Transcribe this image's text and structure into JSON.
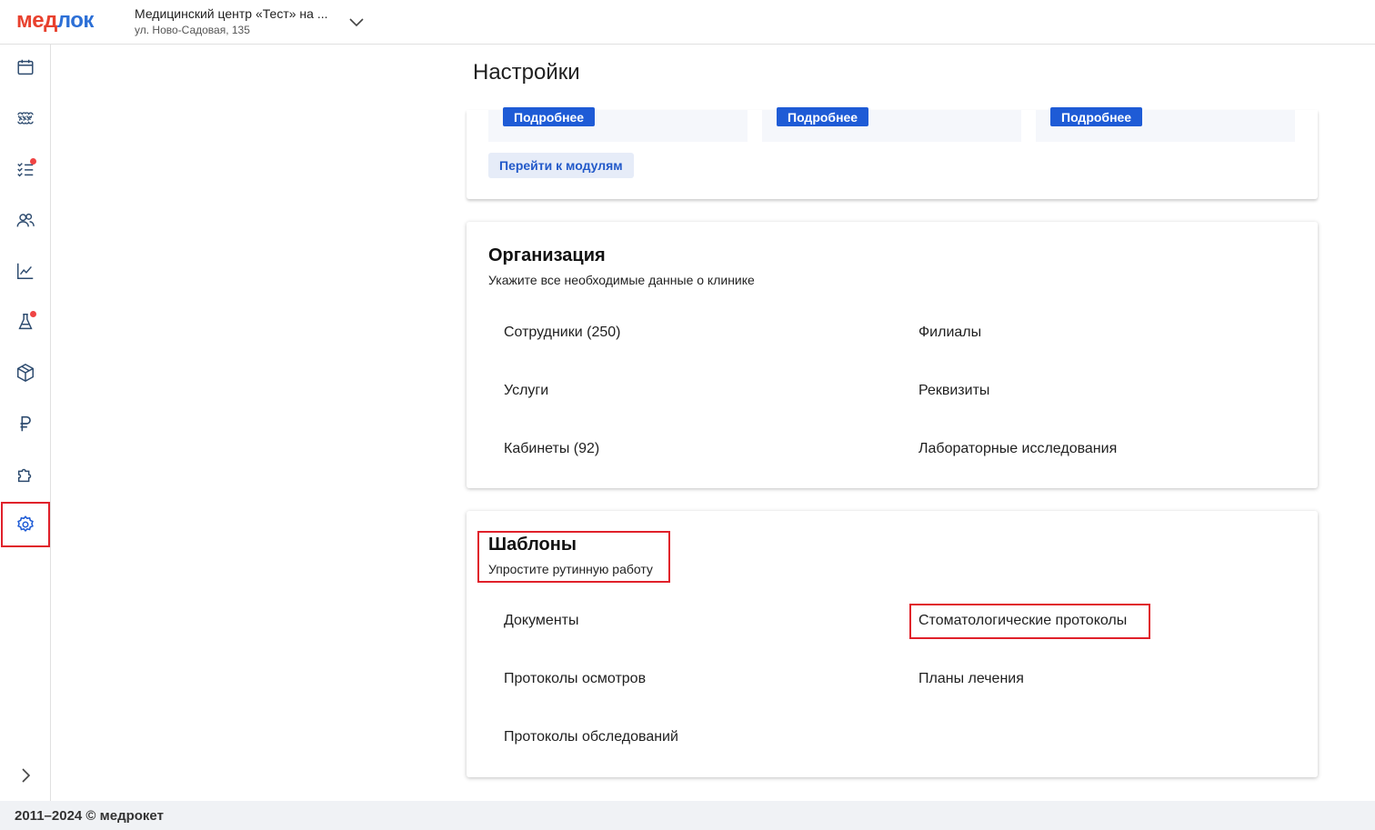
{
  "brand": {
    "logo_part1": "мед",
    "logo_part2": "лок",
    "color_red": "#e8412e",
    "color_blue": "#2c6fd6"
  },
  "clinic": {
    "name": "Медицинский центр «Тест» на ...",
    "address": "ул. Ново-Садовая, 135"
  },
  "sidebar": {
    "items": [
      {
        "icon": "calendar-icon"
      },
      {
        "icon": "tooth-icon"
      },
      {
        "icon": "checklist-icon",
        "badge": true
      },
      {
        "icon": "users-icon"
      },
      {
        "icon": "chart-line-icon"
      },
      {
        "icon": "flask-icon",
        "badge": true
      },
      {
        "icon": "box-icon"
      },
      {
        "icon": "ruble-icon"
      },
      {
        "icon": "puzzle-icon"
      },
      {
        "icon": "gear-icon",
        "active": true
      }
    ],
    "collapse_icon": "chevron-right-icon"
  },
  "page": {
    "title": "Настройки"
  },
  "modules": {
    "more_label": "Подробнее",
    "goto_label": "Перейти к модулям"
  },
  "organization": {
    "title": "Организация",
    "subtitle": "Укажите все необходимые данные о клинике",
    "links": [
      "Сотрудники (250)",
      "Филиалы",
      "Услуги",
      "Реквизиты",
      "Кабинеты (92)",
      "Лабораторные исследования"
    ]
  },
  "templates": {
    "title": "Шаблоны",
    "subtitle": "Упростите рутинную работу",
    "links": [
      "Документы",
      "Стоматологические протоколы",
      "Протоколы осмотров",
      "Планы лечения",
      "Протоколы обследований"
    ]
  },
  "footer": {
    "text": "2011–2024 © медрокет"
  }
}
